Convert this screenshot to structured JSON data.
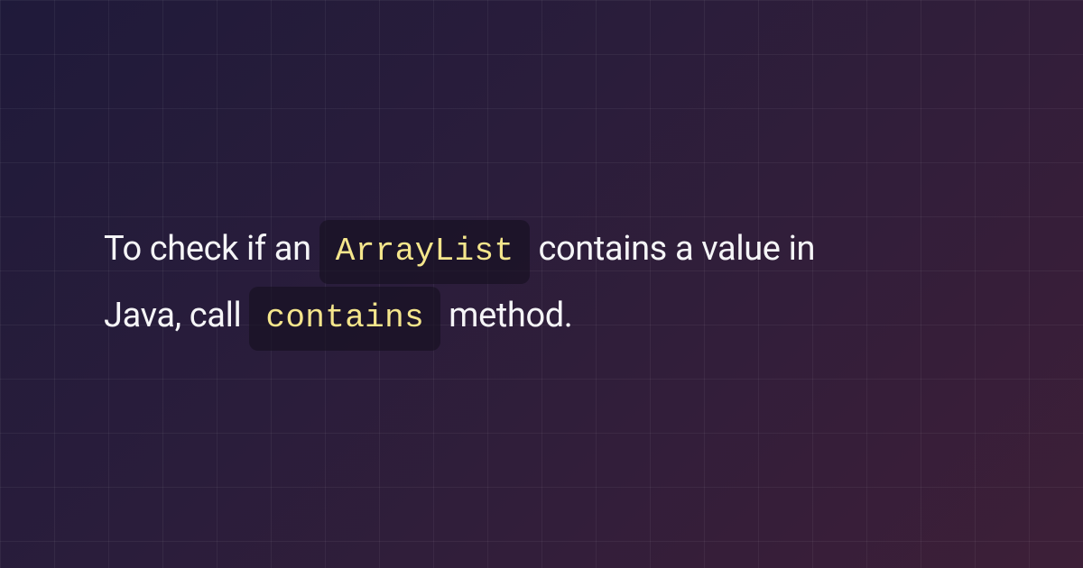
{
  "content": {
    "text_part_1": "To check if an ",
    "code_1": "ArrayList",
    "text_part_2": " contains a value in Java, call ",
    "code_2": "contains",
    "text_part_3": " method."
  }
}
